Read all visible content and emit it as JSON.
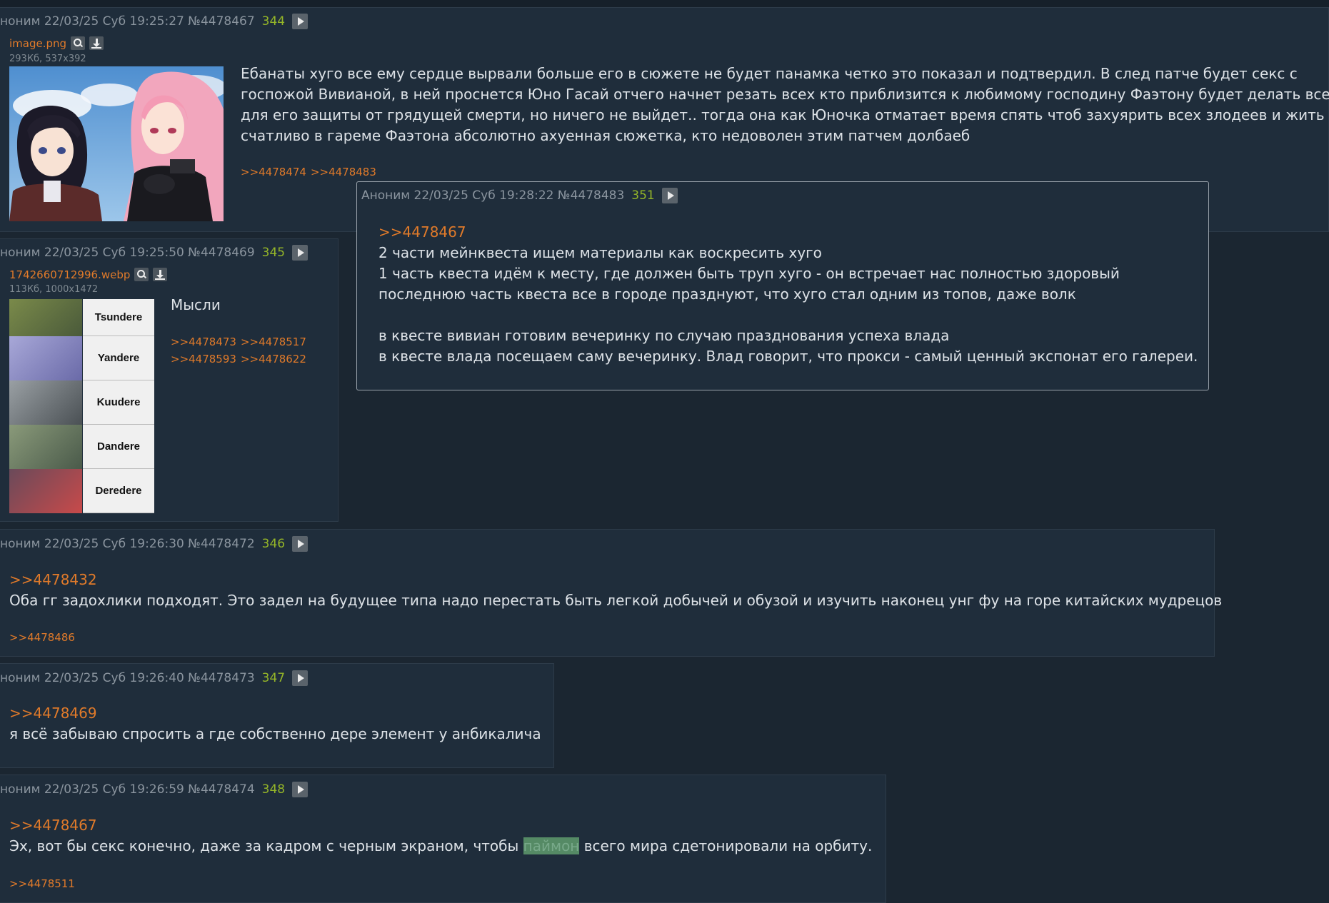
{
  "posts": [
    {
      "name": "ноним",
      "date": "22/03/25 Суб 19:25:27",
      "id": "№4478467",
      "num": "344",
      "file": {
        "name": "image.png",
        "meta": "293Кб, 537x392"
      },
      "lines": [
        "Ебанаты хуго все ему сердце вырвали больше его в сюжете не будет панамка четко это показал и подтвердил. В след патче будет секс с",
        "госпожой Вивианой, в ней проснется Юно Гасай отчего начнет резать всех кто приблизится к любимому господину Фаэтону будет делать все",
        "для его защиты от грядущей смерти, но ничего не выйдет.. тогда она как Юночка отматает время спять чтоб захуярить всех злодеев и жить",
        "счатливо в гареме Фаэтона абсолютно ахуенная сюжетка, кто недоволен этим патчем долбаеб"
      ],
      "replies": [
        ">>4478474",
        ">>4478483"
      ]
    },
    {
      "name": "ноним",
      "date": "22/03/25 Суб 19:25:50",
      "id": "№4478469",
      "num": "345",
      "file": {
        "name": "1742660712996.webp",
        "meta": "113Кб, 1000x1472"
      },
      "text": "Мысли",
      "replies_line1": [
        ">>4478473",
        ">>4478517"
      ],
      "replies_line2": [
        ">>4478593",
        ">>4478622"
      ],
      "tiers": [
        "Tsundere",
        "Yandere",
        "Kuudere",
        "Dandere",
        "Deredere"
      ]
    },
    {
      "name": "ноним",
      "date": "22/03/25 Суб 19:26:30",
      "id": "№4478472",
      "num": "346",
      "quote": ">>4478432",
      "text": "Оба гг задохлики подходят. Это задел на будущее типа надо перестать быть легкой добычей и обузой и изучить наконец унг фу на горе китайских мудрецов",
      "replies": [
        ">>4478486"
      ]
    },
    {
      "name": "ноним",
      "date": "22/03/25 Суб 19:26:40",
      "id": "№4478473",
      "num": "347",
      "quote": ">>4478469",
      "text": "я всё забываю спросить а где собственно дере элемент у анбикалича"
    },
    {
      "name": "ноним",
      "date": "22/03/25 Суб 19:26:59",
      "id": "№4478474",
      "num": "348",
      "quote": ">>4478467",
      "text_before": "Эх, вот бы секс конечно, даже за кадром с черным экраном, чтобы ",
      "spoiler": "паймон",
      "text_after": " всего мира сдетонировали на орбиту.",
      "replies": [
        ">>4478511"
      ]
    }
  ],
  "popup": {
    "name": "Аноним",
    "date": "22/03/25 Суб 19:28:22",
    "id": "№4478483",
    "num": "351",
    "quote": ">>4478467",
    "lines": [
      "2 части мейнквеста ищем материалы как воскресить хуго",
      "1 часть квеста идём к месту, где должен быть труп хуго - он встречает нас полностью здоровый",
      "последнюю часть квеста все в городе празднуют, что хуго стал одним из топов, даже волк",
      "",
      "в квесте вивиан готовим вечеринку по случаю празднования успеха влада",
      "в квесте влада посещаем саму вечеринку. Влад говорит, что прокси - самый ценный экспонат его галереи."
    ]
  },
  "colors": {
    "background": "#1b2631",
    "post_bg": "#1f2d3b",
    "link": "#e07a2a",
    "post_number": "#95b628"
  },
  "icons": [
    "play-icon",
    "search-icon",
    "download-icon"
  ]
}
